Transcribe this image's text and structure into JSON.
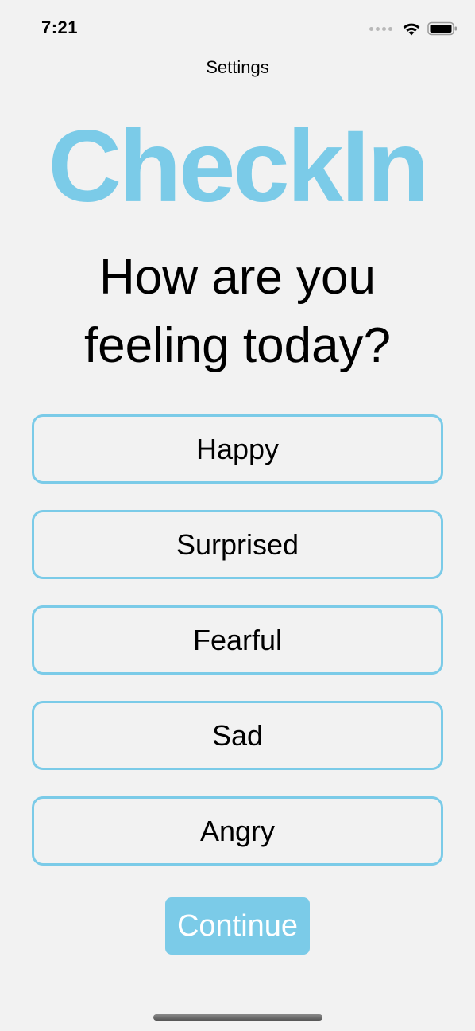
{
  "status_bar": {
    "time": "7:21"
  },
  "nav": {
    "title": "Settings"
  },
  "app": {
    "title": "CheckIn"
  },
  "question": "How are you feeling today?",
  "moods": [
    "Happy",
    "Surprised",
    "Fearful",
    "Sad",
    "Angry"
  ],
  "continue_label": "Continue",
  "colors": {
    "accent": "#7bcbe8",
    "background": "#f2f2f2",
    "continue_button": "#7bcbe8"
  },
  "icons": {
    "cellular": "cellular-signal-icon",
    "wifi": "wifi-icon",
    "battery": "battery-icon"
  }
}
